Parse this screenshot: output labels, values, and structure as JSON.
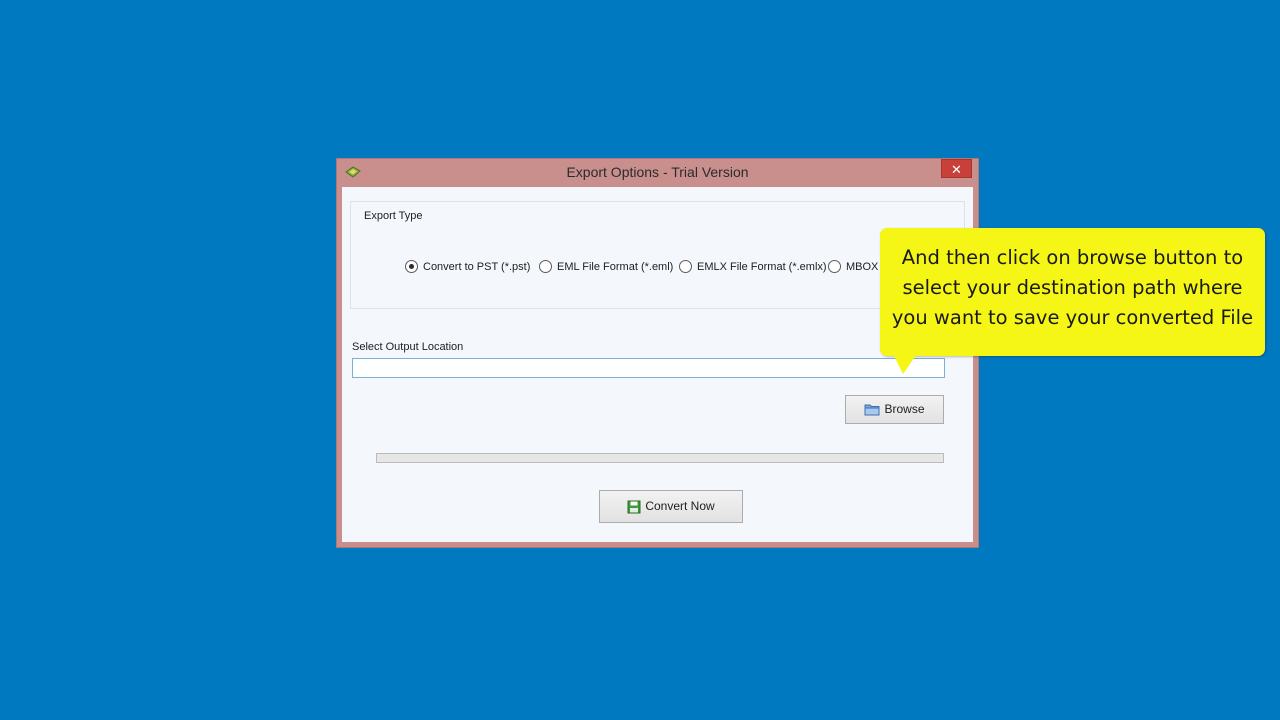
{
  "window": {
    "title": "Export Options - Trial Version",
    "close_glyph": "✕",
    "accent_color": "#c98f8d"
  },
  "export_type": {
    "group_label": "Export Type",
    "options": [
      {
        "label": "Convert to PST (*.pst)",
        "checked": true
      },
      {
        "label": "EML File Format (*.eml)",
        "checked": false
      },
      {
        "label": "EMLX File Format (*.emlx)",
        "checked": false
      },
      {
        "label": "MBOX F",
        "checked": false
      }
    ]
  },
  "output": {
    "label": "Select Output Location",
    "value": "",
    "placeholder": ""
  },
  "buttons": {
    "browse_label": "Browse",
    "browse_icon": "folder-icon",
    "convert_label": "Convert Now",
    "convert_icon": "save-icon"
  },
  "progress": {
    "value": 0
  },
  "callout": {
    "lines": [
      "And then click on browse button to",
      "select your destination path where",
      "you want to save your converted File"
    ],
    "color": "#f5f516"
  }
}
